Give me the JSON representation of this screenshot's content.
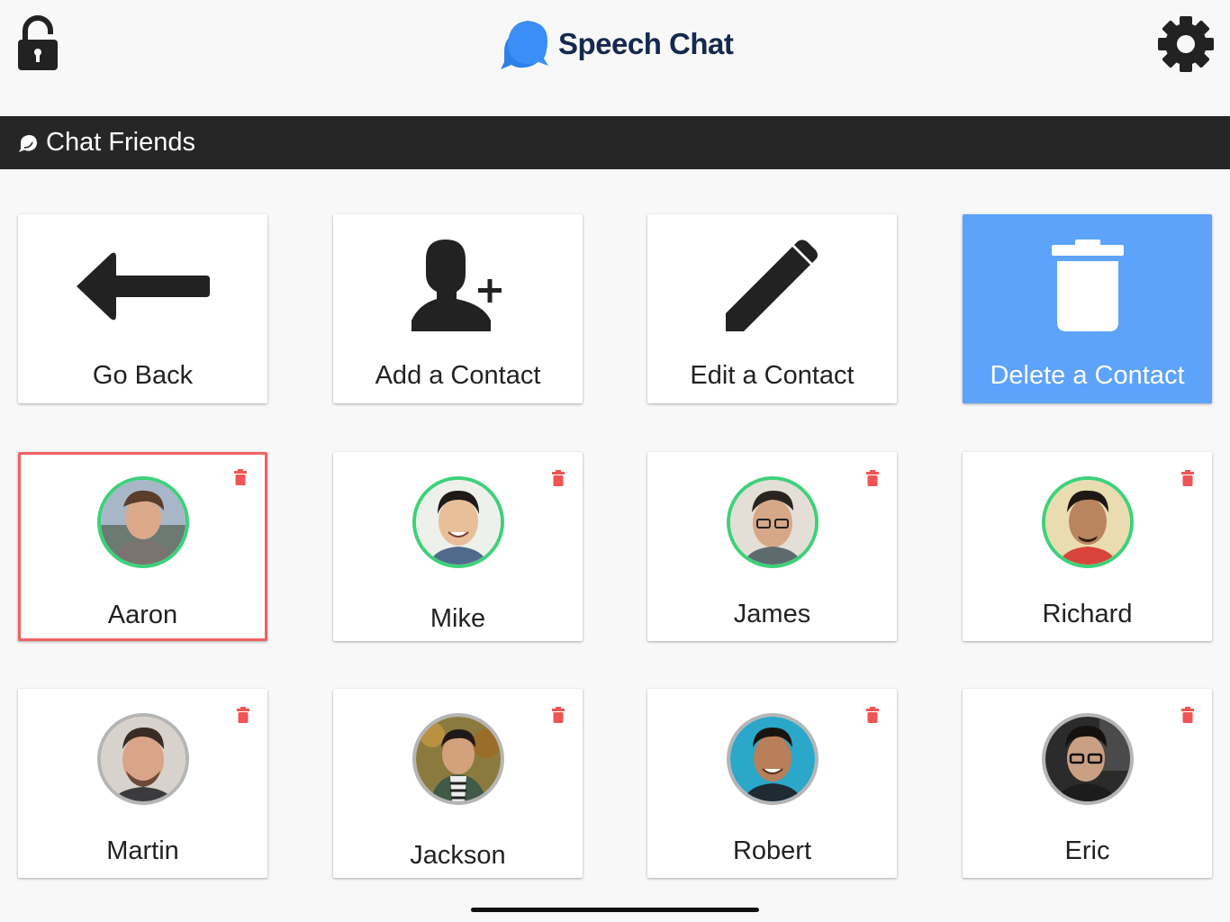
{
  "app": {
    "name": "Speech Chat",
    "brand_color": "#14294d",
    "logo_color": "#2f7fe8"
  },
  "header": {
    "left_icon": "unlock-icon",
    "right_icon": "gear-icon"
  },
  "section": {
    "icon": "chat-bubble-icon",
    "title": "Chat Friends",
    "bar_color": "#262626"
  },
  "actions": [
    {
      "label": "Go Back",
      "icon": "arrow-left-icon",
      "active": false
    },
    {
      "label": "Add a Contact",
      "icon": "add-user-icon",
      "active": false
    },
    {
      "label": "Edit a Contact",
      "icon": "pencil-icon",
      "active": false
    },
    {
      "label": "Delete a Contact",
      "icon": "trash-icon",
      "active": true,
      "active_color": "#5da2fb"
    }
  ],
  "contacts": [
    {
      "name": "Aaron",
      "status": "online",
      "selected": true
    },
    {
      "name": "Mike",
      "status": "online",
      "selected": false
    },
    {
      "name": "James",
      "status": "online",
      "selected": false
    },
    {
      "name": "Richard",
      "status": "online",
      "selected": false
    },
    {
      "name": "Martin",
      "status": "offline",
      "selected": false
    },
    {
      "name": "Jackson",
      "status": "offline",
      "selected": false
    },
    {
      "name": "Robert",
      "status": "offline",
      "selected": false
    },
    {
      "name": "Eric",
      "status": "offline",
      "selected": false
    }
  ],
  "colors": {
    "online_ring": "#3dd17a",
    "offline_ring": "#b5b5b5",
    "selection_border": "#f06262",
    "trash_red": "#f05454"
  }
}
